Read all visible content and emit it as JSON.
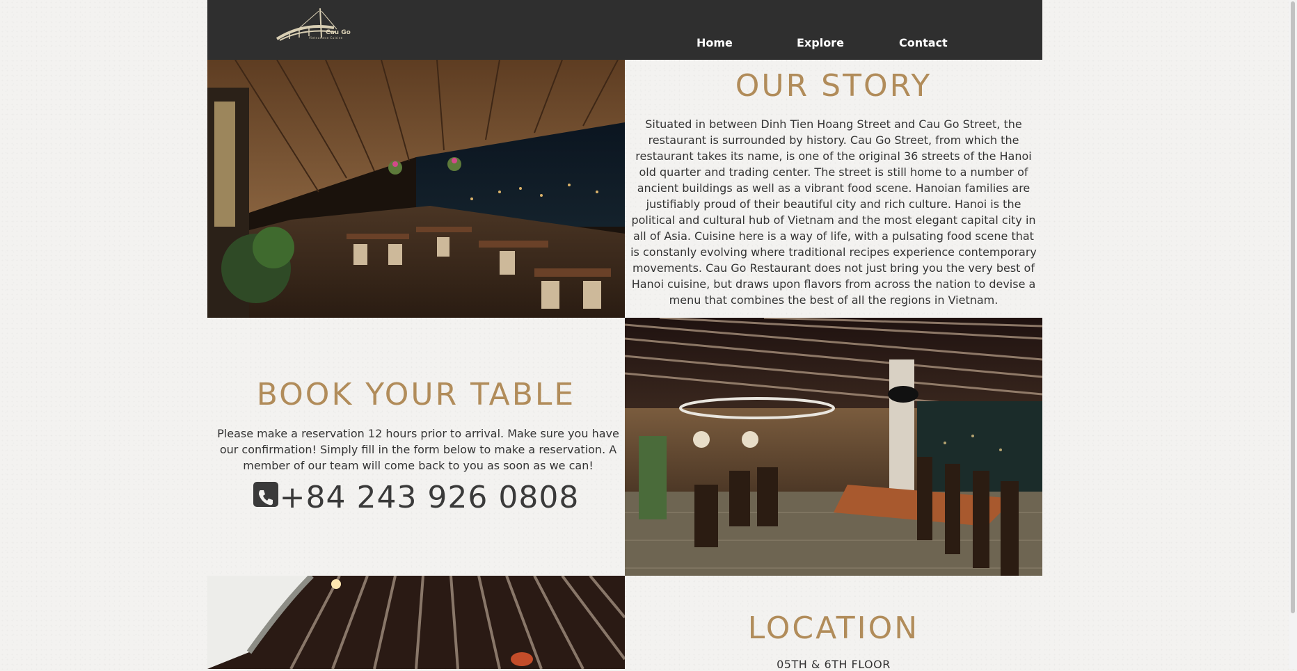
{
  "brand": {
    "name": "Cau Go",
    "tagline": "Vietnamese Cuisine"
  },
  "nav": {
    "items": [
      {
        "label": "Home"
      },
      {
        "label": "Explore"
      },
      {
        "label": "Contact"
      }
    ]
  },
  "story": {
    "title": "OUR STORY",
    "body": "Situated in between Dinh Tien Hoang Street and Cau Go Street, the restaurant is surrounded by history. Cau Go Street, from which the restaurant takes its name, is one of the original 36 streets of the Hanoi old quarter and trading center. The street is still home to a number of ancient buildings as well as a vibrant food scene. Hanoian families are justifiably proud of their beautiful city and rich culture. Hanoi is the political and cultural hub of Vietnam and the most elegant capital city in all of Asia. Cuisine here is a way of life, with a pulsating food scene that is constanly evolving where traditional recipes experience contemporary movements. Cau Go Restaurant does not just bring you the very best of Hanoi cuisine, but draws upon flavors from across the nation to devise a menu that combines the best of all the regions in Vietnam."
  },
  "book": {
    "title": "BOOK YOUR TABLE",
    "body": "Please make a reservation 12 hours prior to arrival. Make sure you have our confirmation! Simply fill in the form below to make a reservation. A member of our team will come back to you as soon as we can!",
    "phone": "+84 243 926 0808"
  },
  "location": {
    "title": "LOCATION",
    "subtitle": "05TH & 6TH FLOOR"
  },
  "colors": {
    "accent": "#b18c5a",
    "nav_bg": "#2f2f2f",
    "text": "#333333"
  }
}
